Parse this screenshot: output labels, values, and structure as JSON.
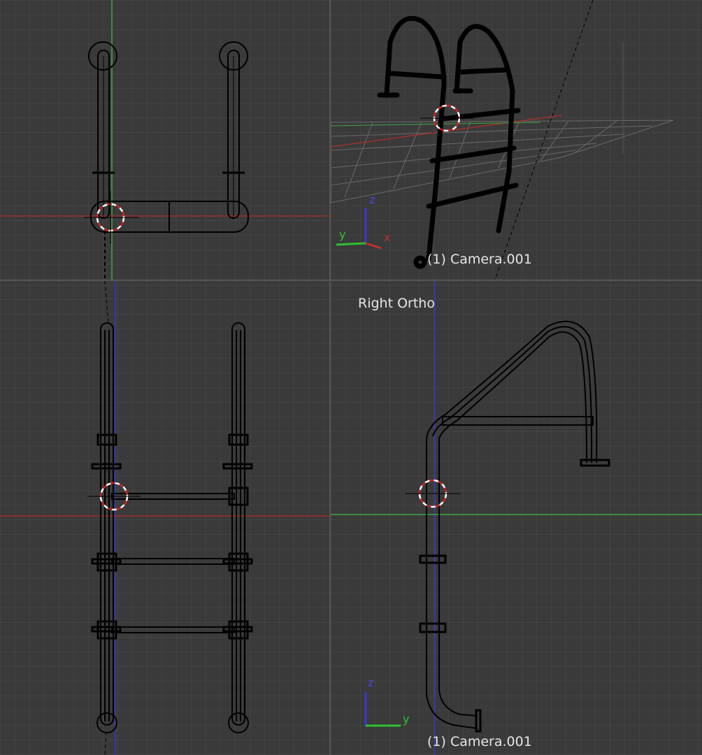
{
  "viewports": {
    "top_left": {
      "view_name": ""
    },
    "top_right": {
      "view_name": "",
      "object_label": "(1) Camera.001",
      "axes": {
        "z": "z",
        "y": "y",
        "x": "x"
      }
    },
    "bottom_left": {
      "view_name": ""
    },
    "bottom_right": {
      "view_name": "Right Ortho",
      "object_label": "(1) Camera.001",
      "axes": {
        "z": "z",
        "y": "y"
      }
    }
  },
  "colors": {
    "background": "#393939",
    "x_axis": "#b03030",
    "y_axis": "#3fa83f",
    "z_axis": "#3838c0",
    "wire": "#000000",
    "cursor": "#d02020"
  }
}
